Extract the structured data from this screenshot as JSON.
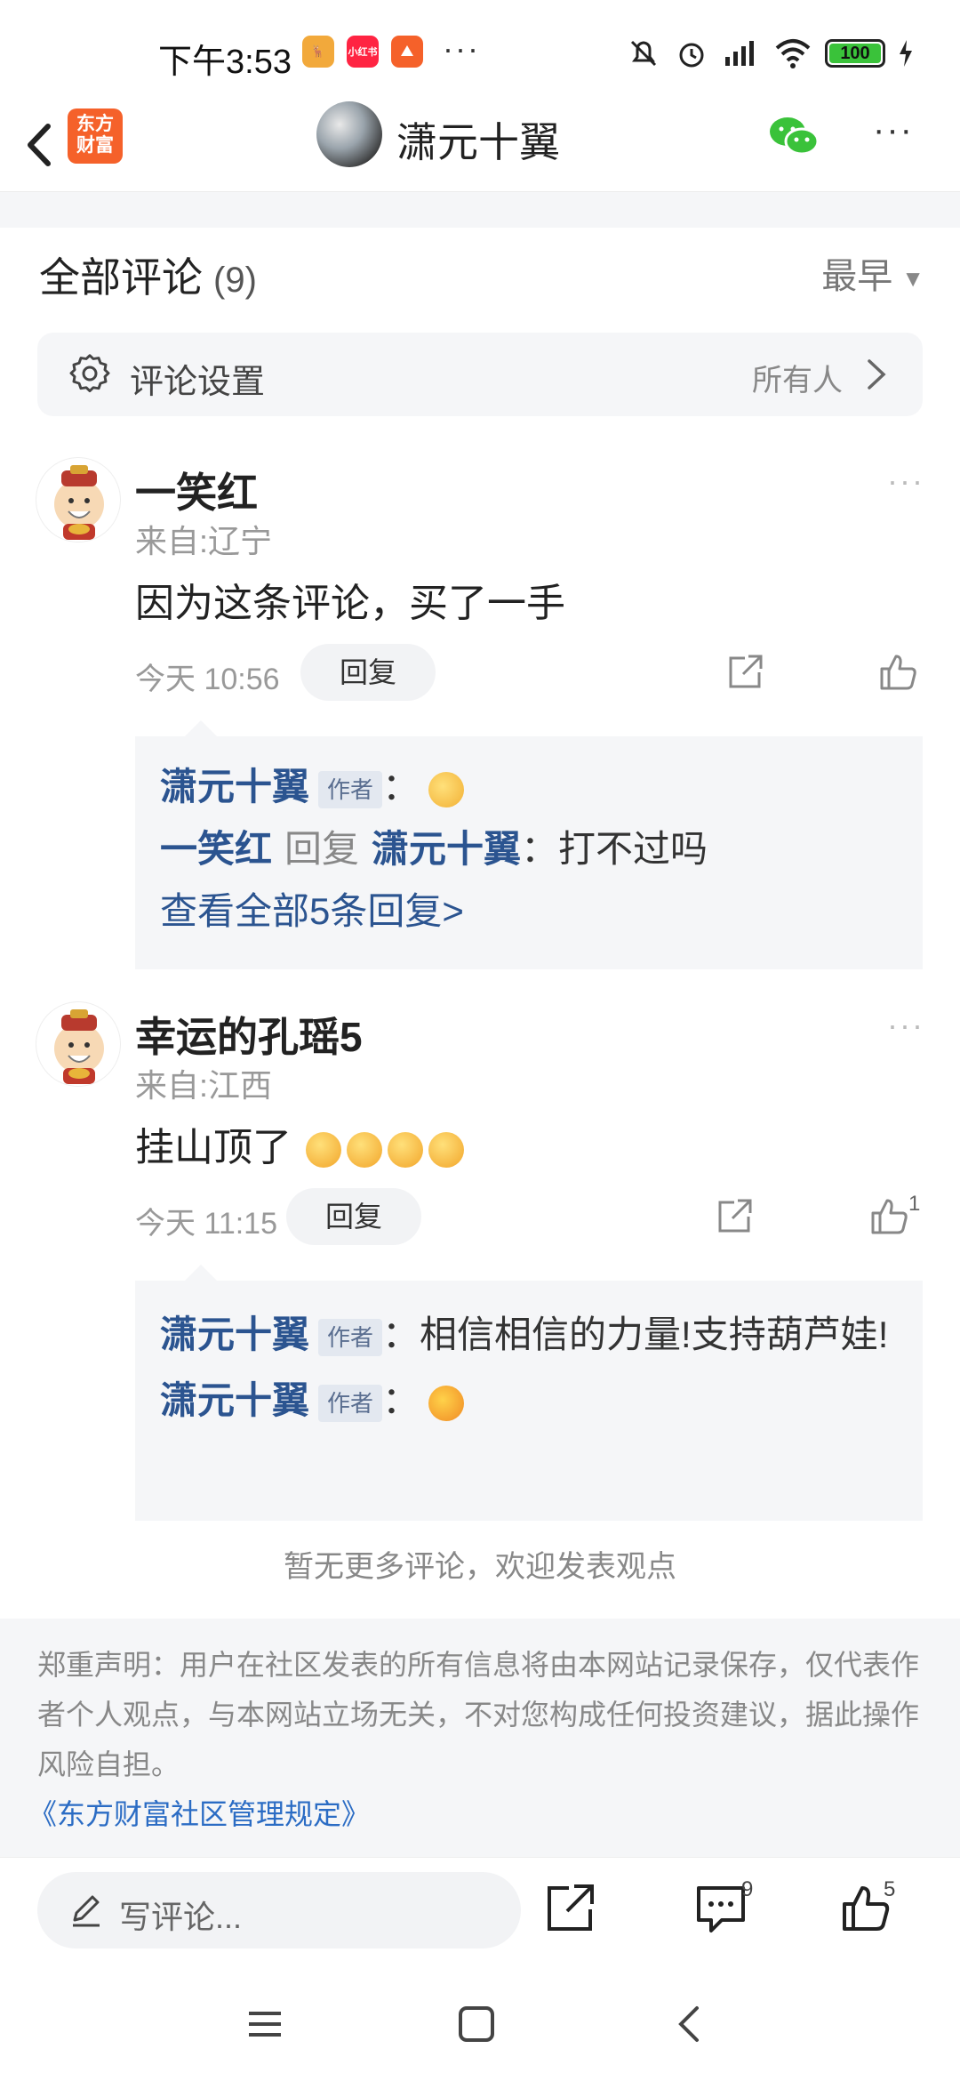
{
  "status_bar": {
    "time": "下午3:53",
    "app_icons": [
      {
        "name": "deer-icon",
        "color": "#f2a93b"
      },
      {
        "name": "xiaohongshu-icon",
        "color": "#ff2442",
        "label": "小红书"
      },
      {
        "name": "toutiao-icon",
        "color": "#f5612a"
      }
    ],
    "more": "···",
    "battery": "100"
  },
  "nav": {
    "logo_text": "东方财富",
    "title": "潇元十翼",
    "more": "···"
  },
  "comments": {
    "header": "全部评论",
    "count": "(9)",
    "sort": "最早",
    "settings_label": "评论设置",
    "settings_value": "所有人"
  },
  "comment_items": [
    {
      "name": "一笑红",
      "location": "来自:辽宁",
      "text": "因为这条评论，买了一手",
      "time": "今天 10:56",
      "reply_label": "回复",
      "likes": "",
      "replies": {
        "r1_name": "潇元十翼",
        "r1_tag": "作者",
        "r1_sep": "：",
        "r2_name": "一笑红",
        "r2_mid": "回复",
        "r2_target": "潇元十翼",
        "r2_text": "：打不过吗",
        "view_all": "查看全部5条回复>"
      }
    },
    {
      "name": "幸运的孔瑶5",
      "location": "来自:江西",
      "text": "挂山顶了",
      "time": "今天 11:15",
      "reply_label": "回复",
      "likes": "1",
      "replies": {
        "r1_name": "潇元十翼",
        "r1_tag": "作者",
        "r1_text": "：相信相信的力量!支持葫芦娃!",
        "r2_name": "潇元十翼",
        "r2_tag": "作者",
        "r2_sep": "："
      }
    }
  ],
  "no_more": "暂无更多评论，欢迎发表观点",
  "disclaimer": {
    "text": "郑重声明：用户在社区发表的所有信息将由本网站记录保存，仅代表作者个人观点，与本网站立场无关，不对您构成任何投资建议，据此操作风险自担。",
    "link": "《东方财富社区管理规定》"
  },
  "bottom_bar": {
    "placeholder": "写评论...",
    "comment_count": "9",
    "like_count": "5"
  },
  "colors": {
    "accent_blue": "#2b5490",
    "brand_orange": "#f5612a",
    "wechat_green": "#3ac23a"
  }
}
